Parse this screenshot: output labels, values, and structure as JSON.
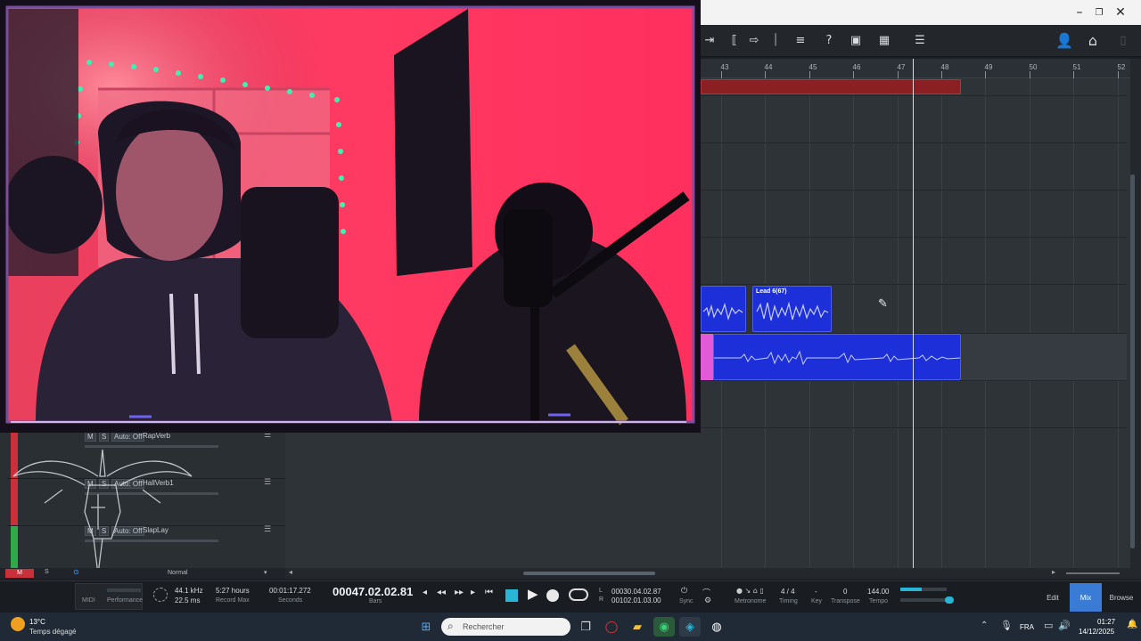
{
  "window": {
    "minimize_icon": "–",
    "maximize_icon": "❐",
    "close_icon": "✕"
  },
  "ruler": {
    "bars": [
      "43",
      "44",
      "45",
      "46",
      "47",
      "48",
      "49",
      "50",
      "51",
      "52"
    ]
  },
  "clips": {
    "lead6_title": "Lead 6(67)"
  },
  "tracks": [
    {
      "m": "M",
      "s": "S",
      "auto": "Auto: Off",
      "name": "RapVerb",
      "color": "#c9313a"
    },
    {
      "m": "M",
      "s": "S",
      "auto": "Auto: Off",
      "name": "HallVerb1",
      "color": "#c9313a"
    },
    {
      "m": "M",
      "s": "S",
      "auto": "Auto: Off",
      "name": "SlapLay",
      "color": "#2faa48"
    }
  ],
  "footer_strip": {
    "m": "M",
    "s": "S",
    "mode": "Normal"
  },
  "transport": {
    "midi_label": "MIDI",
    "performance_label": "Performance",
    "sample_rate": "44.1 kHz",
    "latency": "22.5 ms",
    "record_time": "5:27 hours",
    "record_label": "Record Max",
    "seconds_value": "00:01:17.272",
    "seconds_label": "Seconds",
    "bars_value": "00047.02.02.81",
    "bars_label": "Bars",
    "l_label": "L",
    "r_label": "R",
    "loop_left": "00030.04.02.87",
    "loop_right": "00102.01.03.00",
    "sync_label": "Sync",
    "metronome_label": "Metronome",
    "timing_value": "4 / 4",
    "timing_label": "Timing",
    "key_value": "-",
    "key_label": "Key",
    "transpose_value": "0",
    "transpose_label": "Transpose",
    "tempo_value": "144.00",
    "tempo_label": "Tempo",
    "edit_label": "Edit",
    "mix_label": "Mix",
    "browse_label": "Browse"
  },
  "taskbar": {
    "weather_temp": "13°C",
    "weather_desc": "Temps dégagé",
    "search_placeholder": "Rechercher",
    "language": "FRA",
    "time": "01:27",
    "date": "14/12/2025"
  },
  "colors": {
    "accent": "#3a7bd5",
    "clip_blue": "#1c2fd8",
    "clip_red": "#8a1f24",
    "clip_pink": "#e25ad8",
    "webcam_red": "#ff2f5e"
  }
}
